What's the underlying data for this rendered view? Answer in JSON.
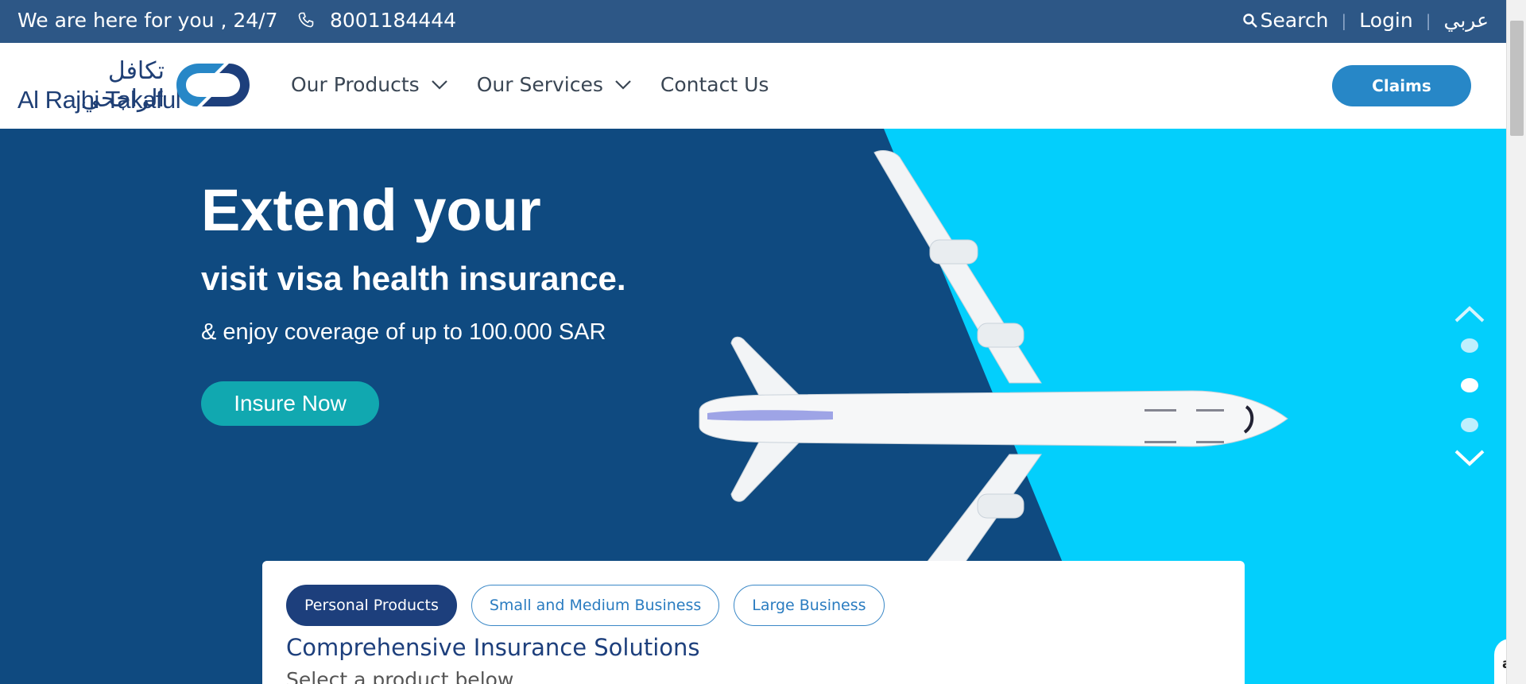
{
  "topbar": {
    "tagline": "We are here for you , 24/7",
    "phone": "8001184444",
    "search_label": "Search",
    "login_label": "Login",
    "language_label": "عربي"
  },
  "nav": {
    "logo_arabic": "تكافل الراجحي",
    "logo_english": "Al Rajhi Takaful",
    "items": [
      {
        "label": "Our Products"
      },
      {
        "label": "Our Services"
      },
      {
        "label": "Contact Us"
      }
    ],
    "claims_label": "Claims"
  },
  "hero": {
    "headline": "Extend your",
    "subheadline": "visit visa health insurance.",
    "tagline": "& enjoy coverage of up to 100.000 SAR",
    "cta_label": "Insure Now",
    "slide_count": 3,
    "active_slide": 2
  },
  "products": {
    "tabs": [
      {
        "label": "Personal Products",
        "active": true
      },
      {
        "label": "Small and Medium Business",
        "active": false
      },
      {
        "label": "Large Business",
        "active": false
      }
    ],
    "title": "Comprehensive Insurance Solutions",
    "hint": "Select a product below"
  },
  "chat_label": "at",
  "colors": {
    "topbar": "#2d5786",
    "hero_dark": "#0f4a80",
    "hero_light": "#03cffc",
    "cta": "#11a8b0",
    "claims": "#2787c7",
    "brand": "#1d3f7c"
  }
}
